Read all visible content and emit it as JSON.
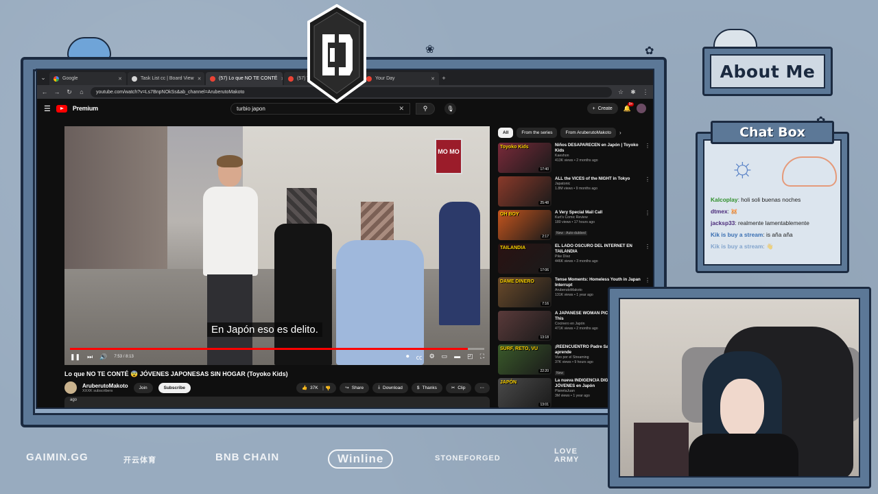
{
  "browser": {
    "tabs": [
      {
        "label": "Google",
        "favicon": "google-icon",
        "active": false
      },
      {
        "label": "Task List cc | Board View",
        "favicon": "tasklist-icon",
        "active": false
      },
      {
        "label": "(57) Lo que NO TE CONTÉ",
        "favicon": "youtube-icon",
        "active": true
      },
      {
        "label": "(57) Things",
        "favicon": "youtube-icon",
        "active": false
      },
      {
        "label": "Your Day",
        "favicon": "youtube-icon",
        "active": false
      }
    ],
    "url": "youtube.com/watch?v=Ls7BnpNOkSs&ab_channel=AruberutoMakoto"
  },
  "youtube": {
    "brand": "Premium",
    "search_value": "turbio japon",
    "create_label": "Create",
    "notif_count": "9+",
    "video": {
      "subtitle": "En Japón eso es delito.",
      "time": "7:53 / 8:13",
      "progress": 0.96,
      "title": "Lo que NO TE CONTÉ 😨 JÓVENES JAPONESAS SIN HOGAR (Toyoko Kids)",
      "shop_sign": "MO MO"
    },
    "channel": {
      "name": "AruberutoMakoto",
      "subs": "XXXK subscribers",
      "join_label": "Join",
      "subscribe_label": "Subscribe"
    },
    "actions": {
      "likes": "37K",
      "share": "Share",
      "download": "Download",
      "thanks": "Thanks",
      "clip": "Clip"
    },
    "desc_snippet": "ago",
    "chips": [
      "All",
      "From the series",
      "From AruberutoMakoto"
    ],
    "recommendations": [
      {
        "title": "Niños DESAPARECEN en Japón | Toyoko Kids",
        "channel": "Kaeshon",
        "meta": "413K views • 2 months ago",
        "duration": "17:40",
        "thumb_text": "Toyoko Kids",
        "badge": "",
        "color": "#7a2a3a"
      },
      {
        "title": "ALL the VICES of the NIGHT in Tokyo",
        "channel": "Japatonic",
        "meta": "1.8M views • 9 months ago",
        "duration": "25:48",
        "thumb_text": "",
        "badge": "",
        "color": "#8a3a2a"
      },
      {
        "title": "A Very Special Mail Call",
        "channel": "Kurt's Comic Review",
        "meta": "180 views • 17 hours ago",
        "duration": "2:17",
        "thumb_text": "OH BOY",
        "badge": "New  ·  Auto-dubbed",
        "color": "#c4551e"
      },
      {
        "title": "EL LADO OSCURO DEL INTERNET EN TAILANDIA",
        "channel": "Pike Díez",
        "meta": "446K views • 3 months ago",
        "duration": "17:06",
        "thumb_text": "TAILANDIA",
        "badge": "",
        "color": "#2a1212"
      },
      {
        "title": "Tense Moments: Homeless Youth in Japan Interrupt",
        "channel": "AruberutoMakoto",
        "meta": "131K views • 1 year ago",
        "duration": "7:16",
        "thumb_text": "DAME DINERO",
        "badge": "",
        "color": "#6a4a2a"
      },
      {
        "title": "A JAPANESE WOMAN PICKING ME UP!! This",
        "channel": "Cocinero en Japón",
        "meta": "471K views • 2 months ago",
        "duration": "13:18",
        "thumb_text": "",
        "badge": "",
        "color": "#5a3a3a"
      },
      {
        "title": "¡REENCUENTRO Padre Sachai 🔥 Neutro aprende",
        "channel": "Vivo por el Streaming",
        "meta": "37K views • 9 hours ago",
        "duration": "22:20",
        "thumb_text": "SURF, RETO, VU",
        "badge": "New",
        "color": "#3a5a2a"
      },
      {
        "title": "La nueva INDIGENCIA DIGI de los JÓVENES en Japón",
        "channel": "PlanetaJuan",
        "meta": "3M views • 1 year ago",
        "duration": "13:01",
        "thumb_text": "JAPÓN",
        "badge": "",
        "color": "#4a4a4a"
      }
    ]
  },
  "overlay": {
    "about_title": "About Me",
    "chat_title": "Chat Box",
    "chat": [
      {
        "user": "Kalcoplay",
        "text": "holi soli buenas noches",
        "color": "green",
        "faded": false
      },
      {
        "user": "dtmex",
        "text": "🐹",
        "color": "purple",
        "faded": false
      },
      {
        "user": "jacksp33",
        "text": "realmente lamentablemente",
        "color": "purple",
        "faded": false
      },
      {
        "user": "Kik is buy a stream",
        "text": "is aña aña",
        "color": "blue",
        "faded": false
      },
      {
        "user": "Kik is buy a stream",
        "text": "👋",
        "color": "blue",
        "faded": true
      }
    ],
    "sponsors": [
      "GAIMIN.GG",
      "开云体育",
      "BNB CHAIN",
      "Winline",
      "STONEFORGED",
      "LOVE ARMY"
    ],
    "colors": {
      "frame": "#5c7897",
      "frame_border": "#1b2a40",
      "background": "#98abbf",
      "youtube_red": "#ff0000"
    }
  }
}
